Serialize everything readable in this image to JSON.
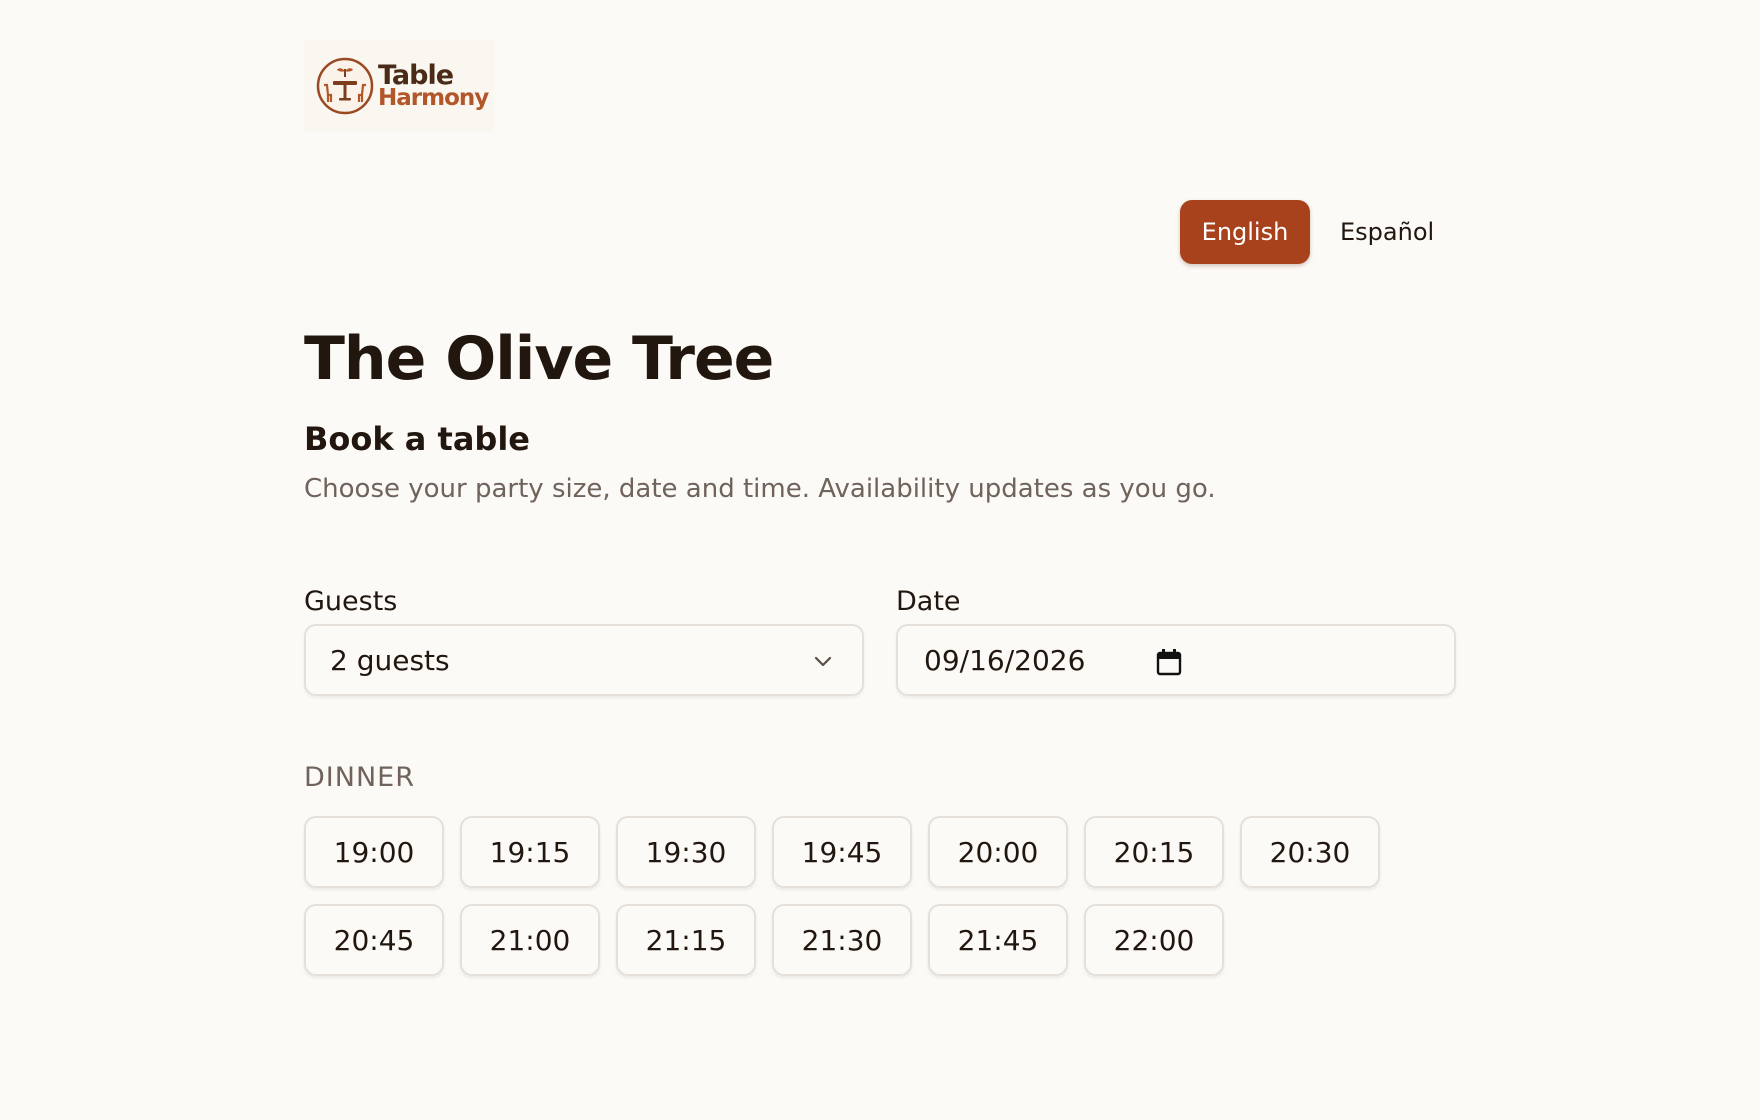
{
  "brand": {
    "line1": "Table",
    "line2": "Harmony",
    "colors": {
      "dark": "#4a2b18",
      "accent": "#b2572a"
    }
  },
  "language": {
    "options": [
      {
        "label": "English",
        "active": true
      },
      {
        "label": "Español",
        "active": false
      }
    ],
    "accent_color": "#a8421c"
  },
  "header": {
    "restaurant_name": "The Olive Tree",
    "subtitle": "Book a table",
    "helper": "Choose your party size, date and time. Availability updates as you go."
  },
  "form": {
    "guests": {
      "label": "Guests",
      "value": "2 guests",
      "icon": "chevron-down-icon"
    },
    "date": {
      "label": "Date",
      "value": "09/16/2026",
      "icon": "calendar-icon"
    }
  },
  "dinner": {
    "label": "DINNER",
    "slots": [
      "19:00",
      "19:15",
      "19:30",
      "19:45",
      "20:00",
      "20:15",
      "20:30",
      "20:45",
      "21:00",
      "21:15",
      "21:30",
      "21:45",
      "22:00"
    ]
  }
}
